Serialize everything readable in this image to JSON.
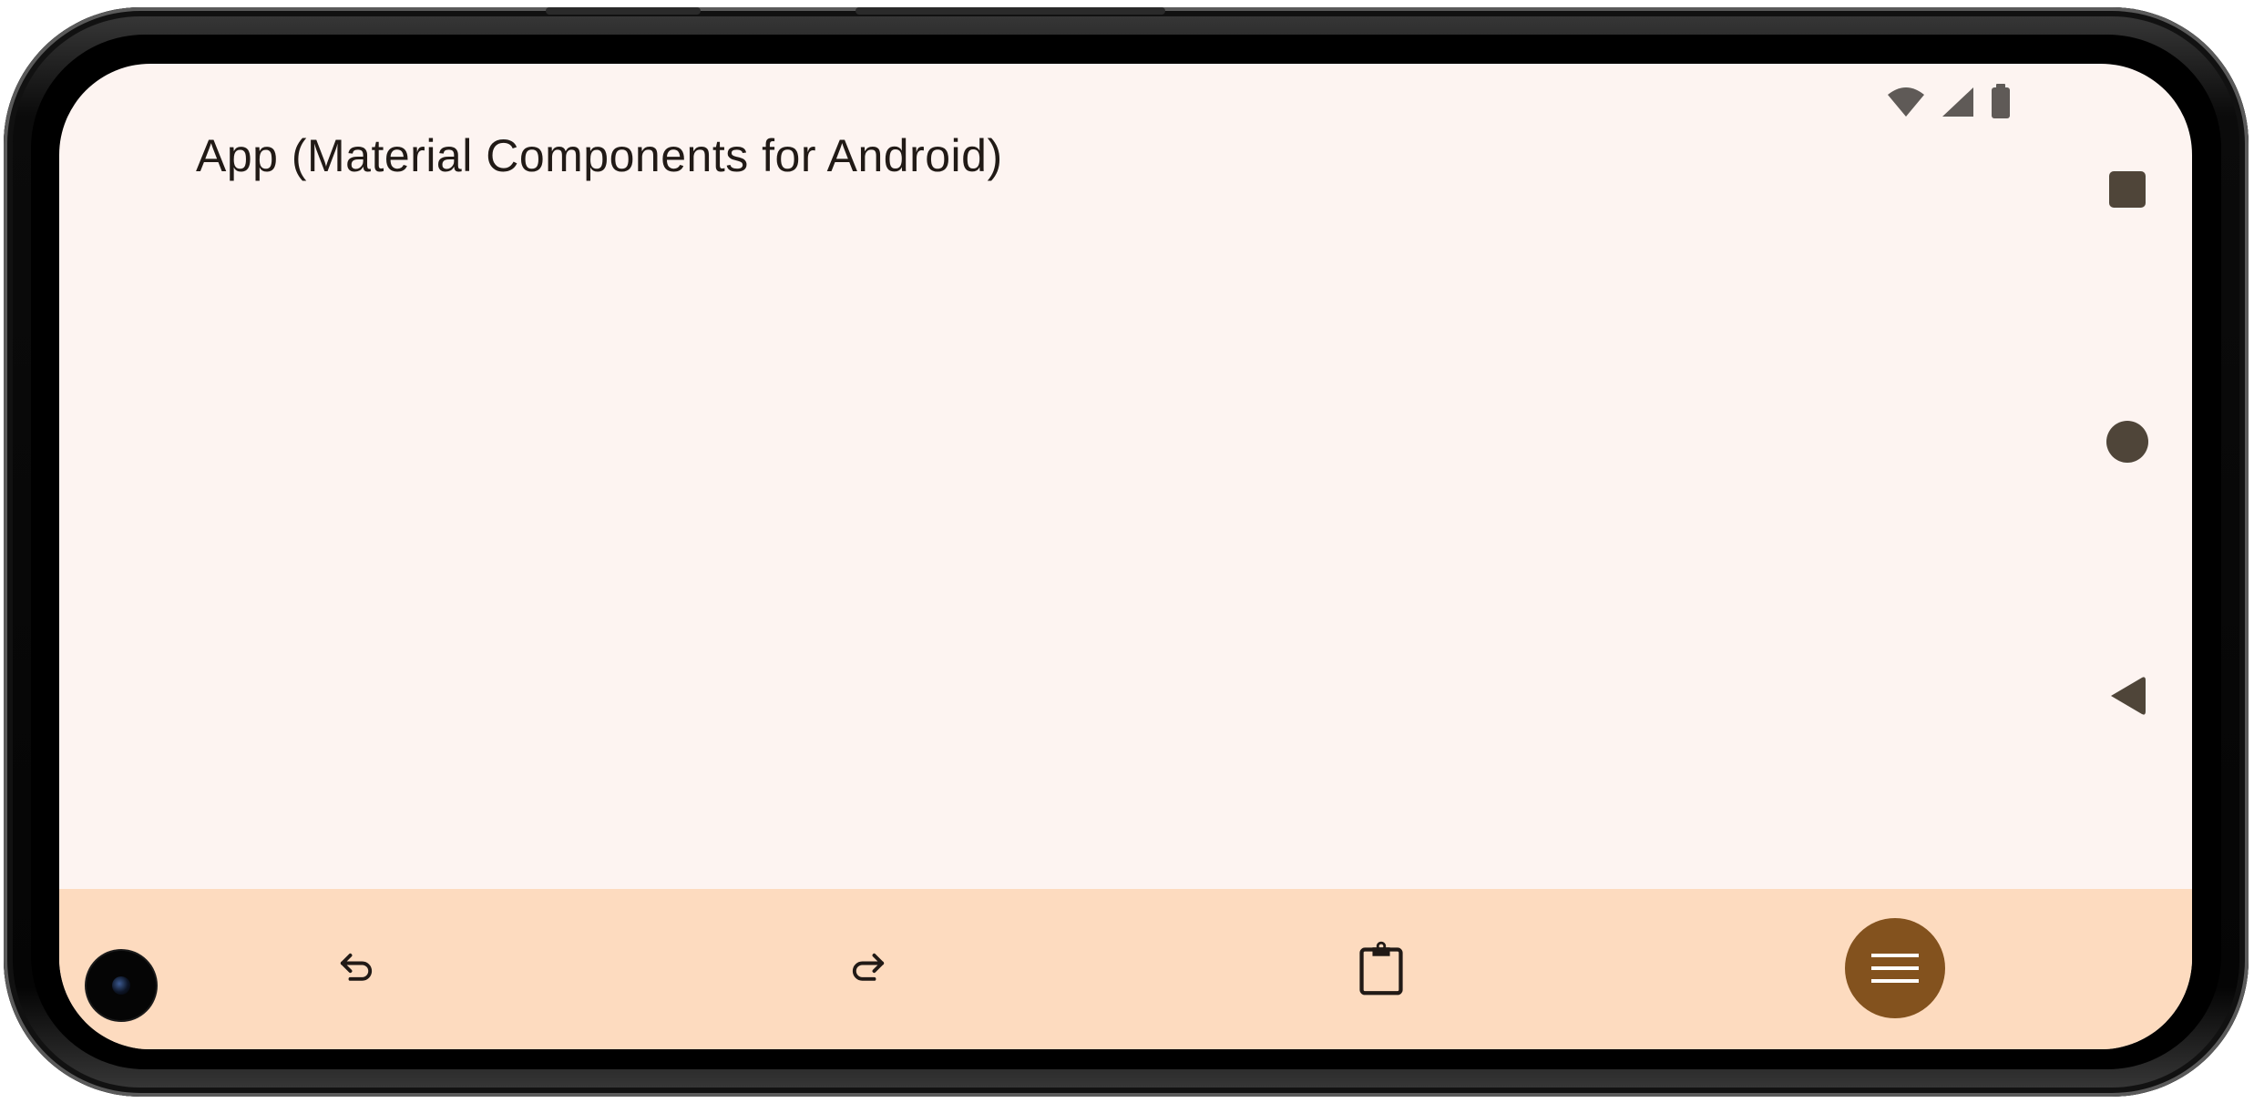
{
  "app": {
    "title": "App (Material Components for Android)"
  },
  "status_bar": {
    "icons": [
      "wifi-icon",
      "cellular-signal-icon",
      "battery-icon"
    ]
  },
  "navigation": {
    "buttons": [
      "recents-icon",
      "home-icon",
      "back-icon"
    ]
  },
  "bottom_app_bar": {
    "actions": [
      "undo-icon",
      "redo-icon",
      "clipboard-icon"
    ],
    "fab_icon": "menu-icon"
  },
  "colors": {
    "screen_background": "#fdf4f1",
    "bottom_bar": "#fddbbf",
    "fab": "#83521e",
    "icon": "#211a16",
    "nav_icon": "#4f4539"
  }
}
